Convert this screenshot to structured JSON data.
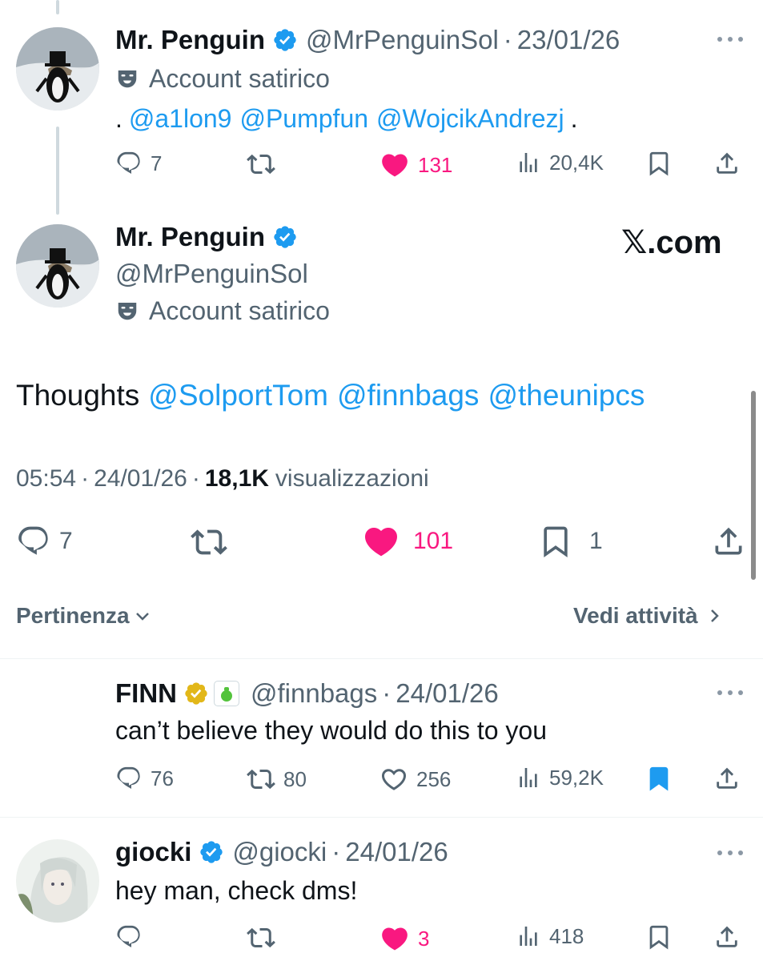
{
  "tweet1": {
    "name": "Mr. Penguin",
    "handle": "@MrPenguinSol",
    "sep": "·",
    "date": "23/01/26",
    "label": "Account satirico",
    "dot_start": ".",
    "mentions": [
      "@a1lon9",
      "@Pumpfun",
      "@WojcikAndrezj"
    ],
    "dot_end": ".",
    "replies": "7",
    "likes": "131",
    "views": "20,4K"
  },
  "main": {
    "name": "Mr. Penguin",
    "handle": "@MrPenguinSol",
    "label": "Account satirico",
    "watermark": "𝕏.com",
    "text_start": "Thoughts",
    "mentions": [
      "@SolportTom",
      "@finnbags",
      "@theunipcs"
    ],
    "time": "05:54",
    "sep": "·",
    "date": "24/01/26",
    "views_count": "18,1K",
    "views_label": "visualizzazioni",
    "replies": "7",
    "likes": "101",
    "bookmarks": "1"
  },
  "sort": {
    "label": "Pertinenza",
    "activity": "Vedi attività"
  },
  "reply1": {
    "name": "FINN",
    "handle": "@finnbags",
    "sep": "·",
    "date": "24/01/26",
    "text": "can’t believe they would do this to you",
    "replies": "76",
    "reposts": "80",
    "likes": "256",
    "views": "59,2K"
  },
  "reply2": {
    "name": "giocki",
    "handle": "@giocki",
    "sep": "·",
    "date": "24/01/26",
    "text": "hey man, check dms!",
    "likes": "3",
    "views": "418"
  },
  "colors": {
    "link": "#1d9bf0",
    "like": "#f91880",
    "muted": "#536471",
    "verified_blue": "#1d9bf0",
    "verified_gold": "#e2b719"
  },
  "icons": [
    "reply-icon",
    "repost-icon",
    "like-icon",
    "views-icon",
    "bookmark-icon",
    "share-icon",
    "verified-badge-icon",
    "theater-masks-icon",
    "more-icon",
    "chevron-down-icon",
    "chevron-right-icon"
  ]
}
